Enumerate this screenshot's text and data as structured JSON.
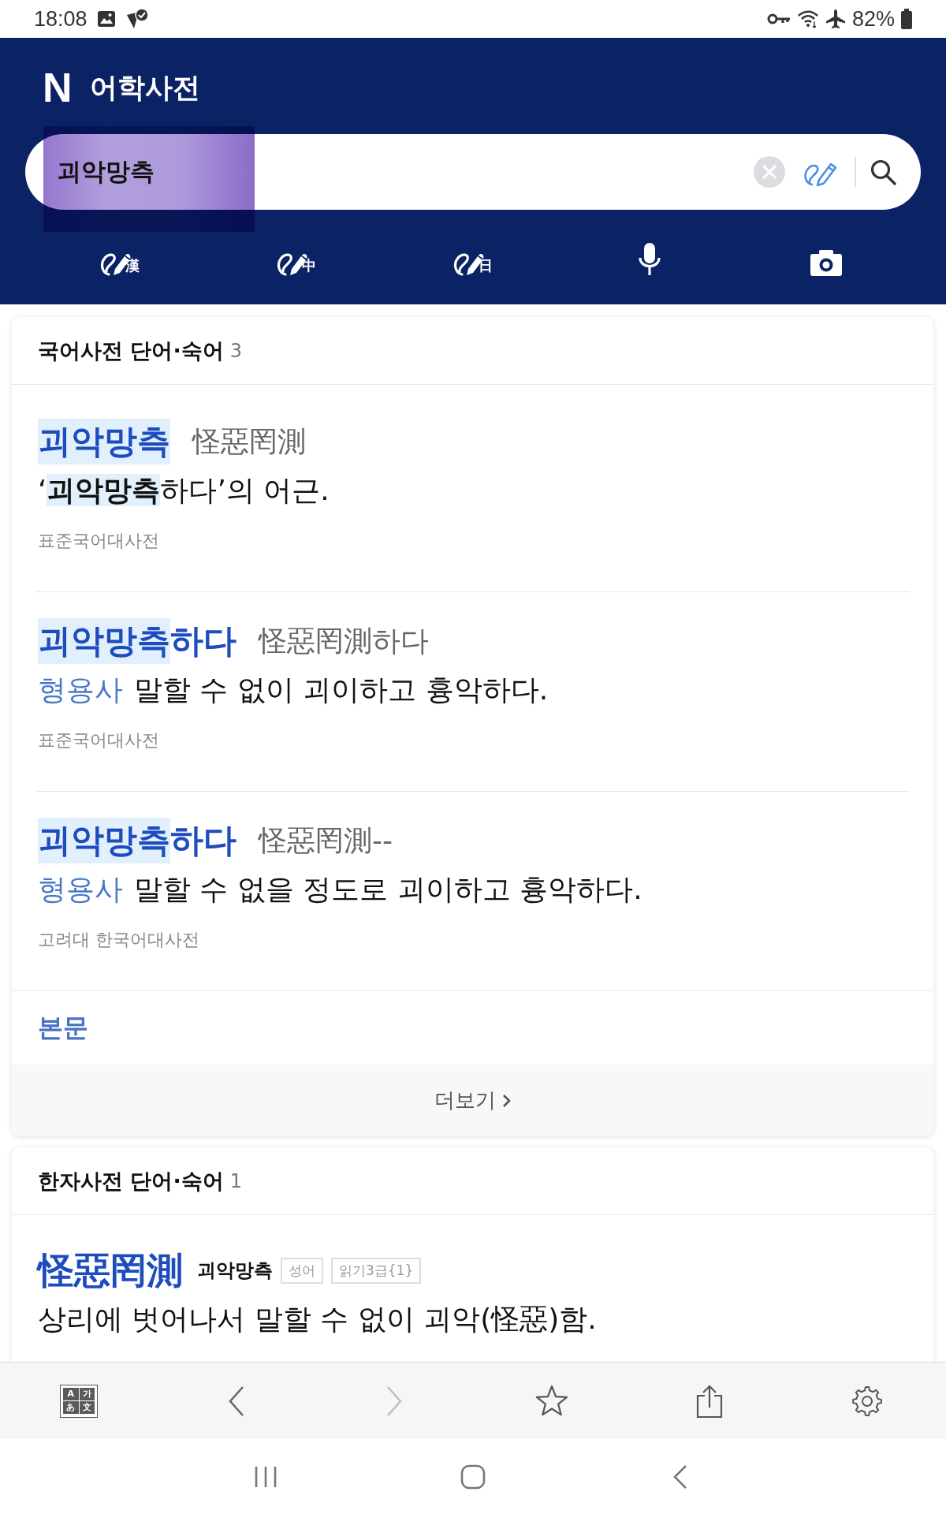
{
  "status_bar": {
    "time": "18:08",
    "battery": "82%"
  },
  "header": {
    "logo": "N",
    "title": "어학사전"
  },
  "search": {
    "value": "괴악망측",
    "highlighted": true
  },
  "tools": [
    {
      "kind": "handwriting",
      "badge": "漢"
    },
    {
      "kind": "handwriting",
      "badge": "中"
    },
    {
      "kind": "handwriting",
      "badge": "日"
    },
    {
      "kind": "voice"
    },
    {
      "kind": "camera"
    }
  ],
  "sections": [
    {
      "title": "국어사전 단어·숙어",
      "count": "3",
      "entries": [
        {
          "kind": "korean",
          "headword": [
            {
              "text": "괴악망측",
              "highlighted": true
            }
          ],
          "hanja": "怪惡罔測",
          "definition": "‘**괴악망측**하다’의 어근.",
          "source": "표준국어대사전"
        },
        {
          "kind": "korean",
          "headword": [
            {
              "text": "괴악망측",
              "highlighted": true
            },
            {
              "text": "하다",
              "highlighted": false
            }
          ],
          "hanja": "怪惡罔測하다",
          "pos": "형용사",
          "definition": "말할 수 없이 괴이하고 흉악하다.",
          "source": "표준국어대사전"
        },
        {
          "kind": "korean",
          "headword": [
            {
              "text": "괴악망측",
              "highlighted": true
            },
            {
              "text": "하다",
              "highlighted": false
            }
          ],
          "hanja": "怪惡罔測--",
          "pos": "형용사",
          "definition": "말할 수 없을 정도로 괴이하고 흉악하다.",
          "source": "고려대 한국어대사전"
        }
      ],
      "body_link": "본문",
      "more": "더보기"
    },
    {
      "title": "한자사전 단어·숙어",
      "count": "1",
      "entries": [
        {
          "kind": "hanja",
          "headword": [
            {
              "text": "怪惡罔測",
              "highlighted": false
            }
          ],
          "reading": "괴악망측",
          "tags": [
            "성어",
            "읽기3급{1}"
          ],
          "definition": "상리에 벗어나서 말할 수 없이 괴악(怪惡)함."
        }
      ]
    }
  ],
  "toolbar": [
    {
      "kind": "translate",
      "glyphs": [
        "A",
        "가",
        "あ",
        "文"
      ]
    },
    {
      "kind": "back",
      "disabled": false
    },
    {
      "kind": "forward",
      "disabled": true
    },
    {
      "kind": "bookmark"
    },
    {
      "kind": "share"
    },
    {
      "kind": "settings"
    }
  ],
  "nav_bar": [
    {
      "kind": "recents"
    },
    {
      "kind": "home"
    },
    {
      "kind": "back"
    }
  ]
}
